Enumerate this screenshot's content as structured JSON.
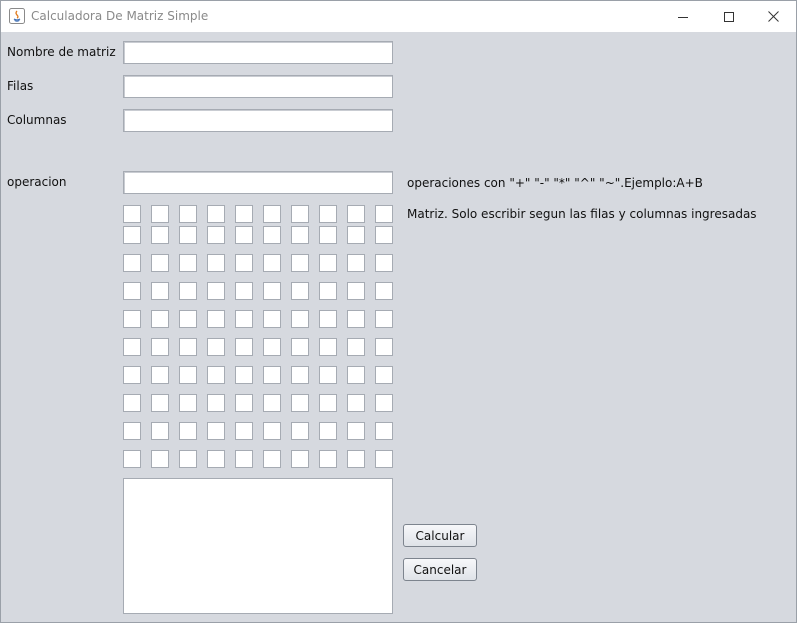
{
  "window": {
    "title": "Calculadora De Matriz Simple"
  },
  "form": {
    "matrix_name_label": "Nombre de matriz",
    "matrix_name_value": "",
    "rows_label": "Filas",
    "rows_value": "",
    "columns_label": "Columnas",
    "columns_value": "",
    "operation_label": "operacion",
    "operation_value": "",
    "operation_hint": "operaciones con \"+\" \"-\" \"*\" \"^\" \"~\".Ejemplo:A+B",
    "matrix_hint": "Matriz. Solo escribir segun las filas y columnas ingresadas"
  },
  "matrix": {
    "rows": 10,
    "cols": 10
  },
  "result": {
    "value": ""
  },
  "buttons": {
    "calculate_label": "Calcular",
    "cancel_label": "Cancelar"
  }
}
